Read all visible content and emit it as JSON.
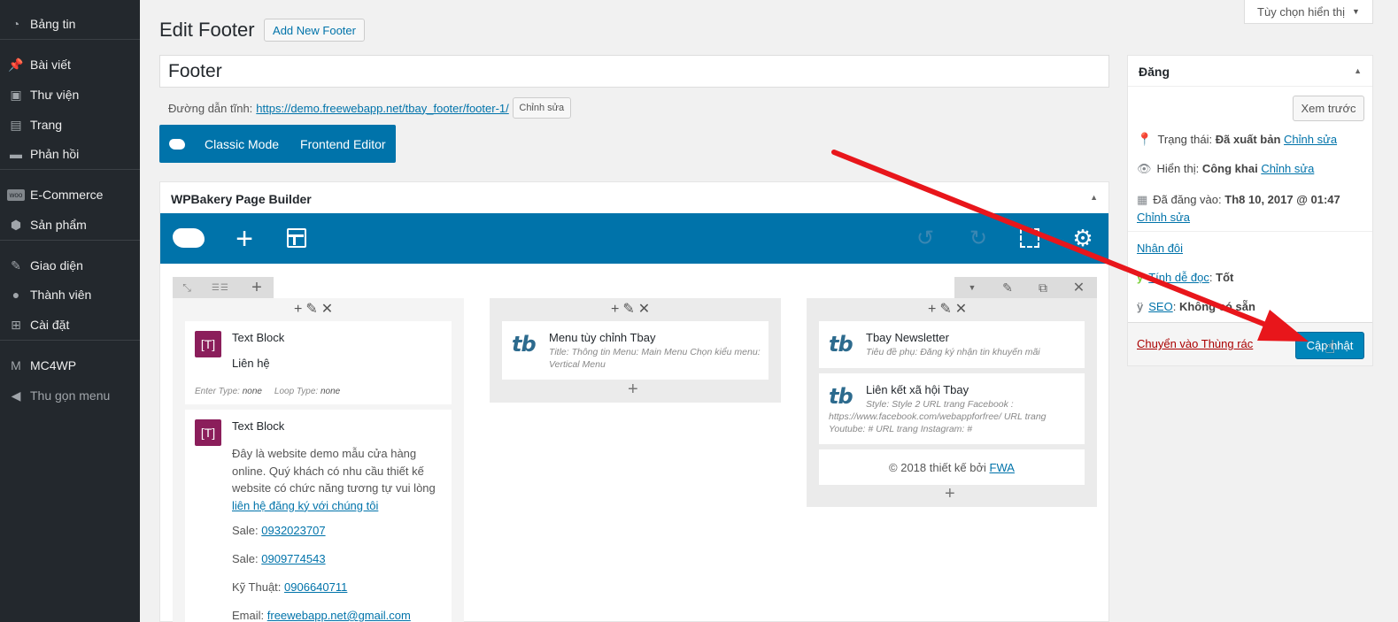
{
  "sidebar": {
    "items": [
      {
        "label": "Bảng tin",
        "icon": "dashboard-icon"
      },
      {
        "label": "Bài viết",
        "icon": "pin-icon"
      },
      {
        "label": "Thư viện",
        "icon": "media-icon"
      },
      {
        "label": "Trang",
        "icon": "page-icon"
      },
      {
        "label": "Phản hồi",
        "icon": "comment-icon"
      },
      {
        "label": "E-Commerce",
        "icon": "woo-icon"
      },
      {
        "label": "Sản phẩm",
        "icon": "box-icon"
      },
      {
        "label": "Giao diện",
        "icon": "brush-icon"
      },
      {
        "label": "Thành viên",
        "icon": "user-icon"
      },
      {
        "label": "Cài đặt",
        "icon": "settings-icon"
      },
      {
        "label": "MC4WP",
        "icon": "mc4wp-icon"
      },
      {
        "label": "Thu gọn menu",
        "icon": "collapse-icon"
      }
    ]
  },
  "screen_options": "Tùy chọn hiển thị",
  "header": {
    "title": "Edit Footer",
    "add_new": "Add New Footer"
  },
  "post_title": "Footer",
  "permalink": {
    "label": "Đường dẫn tĩnh:",
    "url": "https://demo.freewebapp.net/tbay_footer/footer-1/",
    "edit": "Chỉnh sửa"
  },
  "mode_buttons": {
    "classic": "Classic Mode",
    "frontend": "Frontend Editor"
  },
  "wpb": {
    "title": "WPBakery Page Builder"
  },
  "columns": {
    "col1": [
      {
        "title": "Text Block",
        "body": "Liên hệ",
        "meta1_label": "Enter Type:",
        "meta1_val": "none",
        "meta2_label": "Loop Type:",
        "meta2_val": "none"
      },
      {
        "title": "Text Block",
        "para": "Đây là website demo mẫu cửa hàng online. Quý khách có nhu cầu thiết kế website có chức năng tương tự vui lòng",
        "link": "liên hệ đăng ký với chúng tôi",
        "sale1_label": "Sale:",
        "sale1": "0932023707",
        "sale2_label": "Sale:",
        "sale2": "0909774543",
        "tech_label": "Kỹ Thuật:",
        "tech": "0906640711",
        "email_label": "Email:",
        "email": "freewebapp.net@gmail.com"
      }
    ],
    "col2": [
      {
        "title": "Menu tùy chỉnh Tbay",
        "sub": "Title: Thông tin  Menu: Main Menu  Chọn kiểu menu: Vertical Menu"
      }
    ],
    "col3": [
      {
        "title": "Tbay Newsletter",
        "sub": "Tiêu đề phụ: Đăng ký nhận tin khuyến mãi"
      },
      {
        "title": "Liên kết xã hội Tbay",
        "sub": "Style: Style 2  URL trang Facebook : https://www.facebook.com/webappforfree/  URL trang Youtube: #  URL trang Instagram: #"
      },
      {
        "copyright": "© 2018 thiết kế bởi",
        "link": "FWA"
      }
    ]
  },
  "publish": {
    "title": "Đăng",
    "preview": "Xem trước",
    "status_label": "Trạng thái:",
    "status_val": "Đã xuất bản",
    "status_edit": "Chỉnh sửa",
    "vis_label": "Hiển thị:",
    "vis_val": "Công khai",
    "vis_edit": "Chỉnh sửa",
    "date_label": "Đã đăng vào:",
    "date_val": "Th8 10, 2017 @ 01:47",
    "date_edit": "Chỉnh sửa",
    "duplicate": "Nhân đôi",
    "read_label": "Tính dễ đọc",
    "read_val": "Tốt",
    "seo_label": "SEO",
    "seo_val": "Không có sẵn",
    "trash": "Chuyển vào Thùng rác",
    "update": "Cập nhật"
  },
  "colors": {
    "accent": "#0073aa",
    "arrow": "#e8161b",
    "sidebar": "#23282d"
  }
}
